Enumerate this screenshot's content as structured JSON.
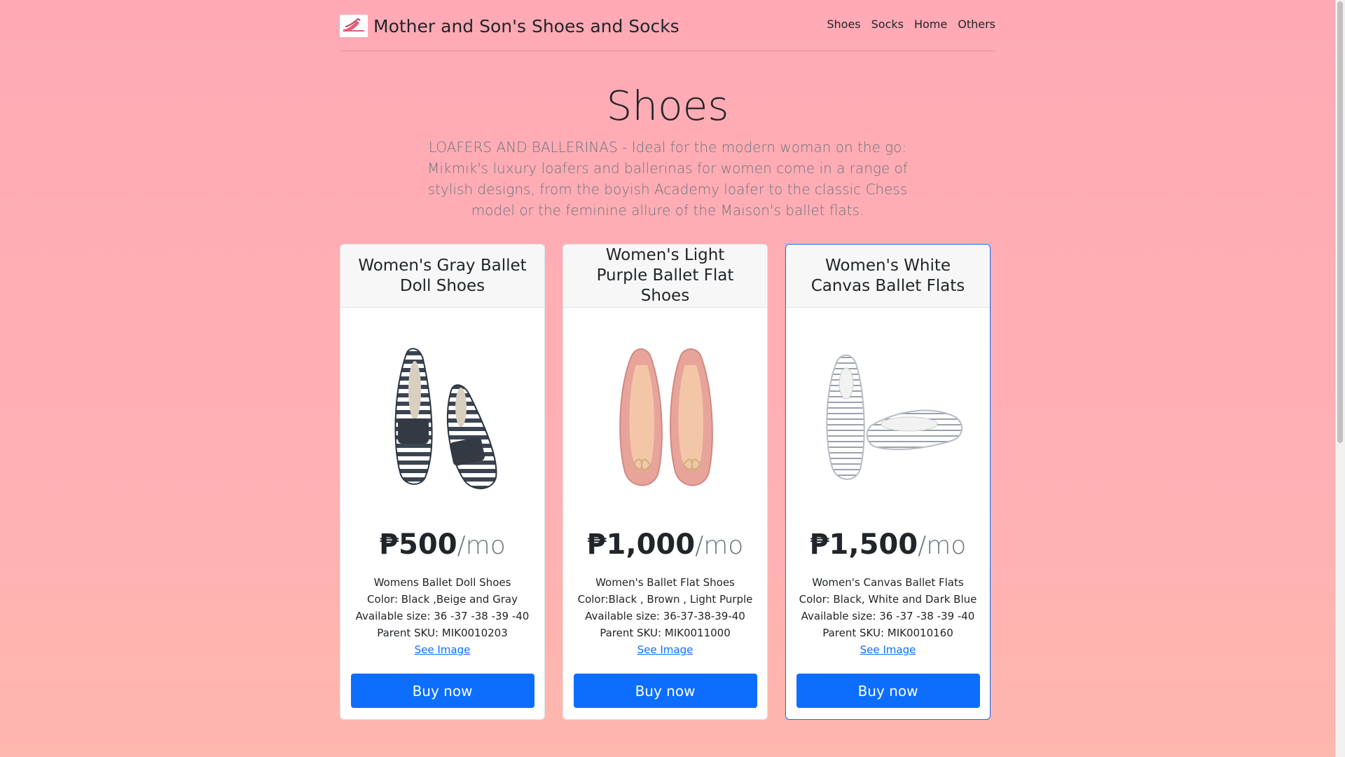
{
  "brand": {
    "name": "Mother and Son's Shoes and Socks",
    "logo_icon": "shoe-icon"
  },
  "nav": [
    "Shoes",
    "Socks",
    "Home",
    "Others"
  ],
  "hero": {
    "title": "Shoes",
    "description": "LOAFERS AND BALLERINAS - Ideal for the modern woman on the go: Mikmik's luxury loafers and ballerinas for women come in a range of stylish designs, from the boyish Academy loafer to the classic Chess model or the feminine allure of the Maison's ballet flats."
  },
  "products": [
    {
      "title": "Women's Gray Ballet Doll Shoes",
      "price": "₱500",
      "unit": "/mo",
      "lines": [
        "Womens Ballet Doll Shoes",
        "Color: Black ,Beige and Gray",
        "Available size: 36 -37 -38 -39 -40",
        "Parent SKU: MIK0010203"
      ],
      "link": "See Image",
      "button": "Buy now"
    },
    {
      "title": "Women's Light Purple Ballet Flat Shoes",
      "price": "₱1,000",
      "unit": "/mo",
      "lines": [
        "Women's Ballet Flat Shoes",
        "Color:Black , Brown , Light Purple",
        "Available size: 36-37-38-39-40",
        "Parent SKU: MIK0011000"
      ],
      "link": "See Image",
      "button": "Buy now"
    },
    {
      "title": "Women's White Canvas Ballet Flats",
      "price": "₱1,500",
      "unit": "/mo",
      "lines": [
        "Women's Canvas Ballet Flats",
        "Color: Black, White and Dark Blue",
        "Available size: 36 -37 -38 -39 -40",
        "Parent SKU: MIK0010160"
      ],
      "link": "See Image",
      "button": "Buy now"
    }
  ],
  "colors": {
    "accent": "#0d6efd",
    "background": "#ffaab5"
  }
}
